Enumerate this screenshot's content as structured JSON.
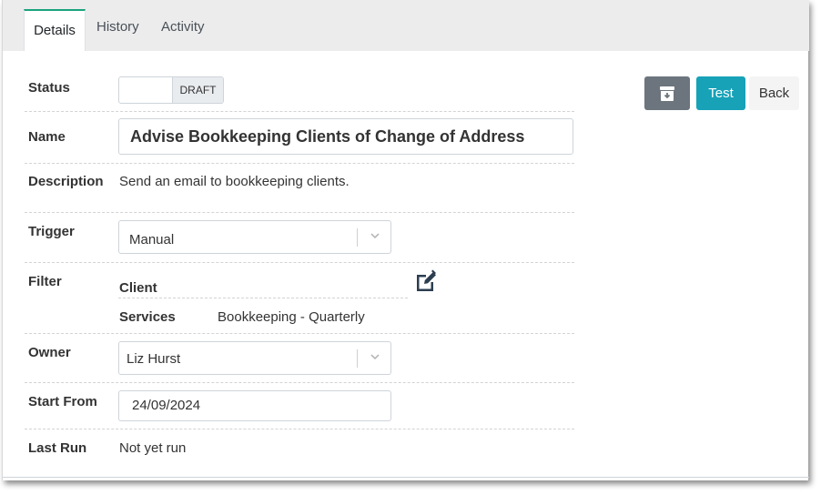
{
  "tabs": [
    {
      "label": "Details",
      "active": true
    },
    {
      "label": "History",
      "active": false
    },
    {
      "label": "Activity",
      "active": false
    }
  ],
  "form": {
    "status": {
      "label": "Status",
      "toggle_text": "DRAFT"
    },
    "name": {
      "label": "Name",
      "value": "Advise Bookkeeping Clients of Change of Address"
    },
    "description": {
      "label": "Description",
      "value": "Send an email to bookkeeping clients."
    },
    "trigger": {
      "label": "Trigger",
      "value": "Manual"
    },
    "filter": {
      "label": "Filter",
      "client_label": "Client",
      "services_label": "Services",
      "services_value": "Bookkeeping - Quarterly"
    },
    "owner": {
      "label": "Owner",
      "value": "Liz Hurst"
    },
    "start_from": {
      "label": "Start From",
      "value": "24/09/2024"
    },
    "last_run": {
      "label": "Last Run",
      "value": "Not yet run"
    }
  },
  "actions": {
    "test_label": "Test",
    "back_label": "Back",
    "archive_icon": "archive-icon"
  },
  "colors": {
    "active_tab_accent": "#1aa37e",
    "test_button": "#17a2b8",
    "archive_button": "#6c757d"
  }
}
